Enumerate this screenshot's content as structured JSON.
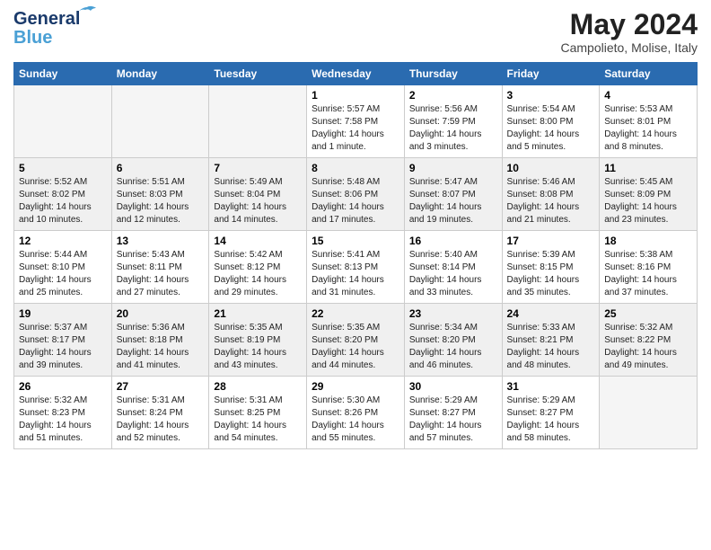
{
  "header": {
    "logo_line1": "General",
    "logo_line2": "Blue",
    "month": "May 2024",
    "location": "Campolieto, Molise, Italy"
  },
  "days_of_week": [
    "Sunday",
    "Monday",
    "Tuesday",
    "Wednesday",
    "Thursday",
    "Friday",
    "Saturday"
  ],
  "weeks": [
    [
      {
        "day": "",
        "info": ""
      },
      {
        "day": "",
        "info": ""
      },
      {
        "day": "",
        "info": ""
      },
      {
        "day": "1",
        "info": "Sunrise: 5:57 AM\nSunset: 7:58 PM\nDaylight: 14 hours\nand 1 minute."
      },
      {
        "day": "2",
        "info": "Sunrise: 5:56 AM\nSunset: 7:59 PM\nDaylight: 14 hours\nand 3 minutes."
      },
      {
        "day": "3",
        "info": "Sunrise: 5:54 AM\nSunset: 8:00 PM\nDaylight: 14 hours\nand 5 minutes."
      },
      {
        "day": "4",
        "info": "Sunrise: 5:53 AM\nSunset: 8:01 PM\nDaylight: 14 hours\nand 8 minutes."
      }
    ],
    [
      {
        "day": "5",
        "info": "Sunrise: 5:52 AM\nSunset: 8:02 PM\nDaylight: 14 hours\nand 10 minutes."
      },
      {
        "day": "6",
        "info": "Sunrise: 5:51 AM\nSunset: 8:03 PM\nDaylight: 14 hours\nand 12 minutes."
      },
      {
        "day": "7",
        "info": "Sunrise: 5:49 AM\nSunset: 8:04 PM\nDaylight: 14 hours\nand 14 minutes."
      },
      {
        "day": "8",
        "info": "Sunrise: 5:48 AM\nSunset: 8:06 PM\nDaylight: 14 hours\nand 17 minutes."
      },
      {
        "day": "9",
        "info": "Sunrise: 5:47 AM\nSunset: 8:07 PM\nDaylight: 14 hours\nand 19 minutes."
      },
      {
        "day": "10",
        "info": "Sunrise: 5:46 AM\nSunset: 8:08 PM\nDaylight: 14 hours\nand 21 minutes."
      },
      {
        "day": "11",
        "info": "Sunrise: 5:45 AM\nSunset: 8:09 PM\nDaylight: 14 hours\nand 23 minutes."
      }
    ],
    [
      {
        "day": "12",
        "info": "Sunrise: 5:44 AM\nSunset: 8:10 PM\nDaylight: 14 hours\nand 25 minutes."
      },
      {
        "day": "13",
        "info": "Sunrise: 5:43 AM\nSunset: 8:11 PM\nDaylight: 14 hours\nand 27 minutes."
      },
      {
        "day": "14",
        "info": "Sunrise: 5:42 AM\nSunset: 8:12 PM\nDaylight: 14 hours\nand 29 minutes."
      },
      {
        "day": "15",
        "info": "Sunrise: 5:41 AM\nSunset: 8:13 PM\nDaylight: 14 hours\nand 31 minutes."
      },
      {
        "day": "16",
        "info": "Sunrise: 5:40 AM\nSunset: 8:14 PM\nDaylight: 14 hours\nand 33 minutes."
      },
      {
        "day": "17",
        "info": "Sunrise: 5:39 AM\nSunset: 8:15 PM\nDaylight: 14 hours\nand 35 minutes."
      },
      {
        "day": "18",
        "info": "Sunrise: 5:38 AM\nSunset: 8:16 PM\nDaylight: 14 hours\nand 37 minutes."
      }
    ],
    [
      {
        "day": "19",
        "info": "Sunrise: 5:37 AM\nSunset: 8:17 PM\nDaylight: 14 hours\nand 39 minutes."
      },
      {
        "day": "20",
        "info": "Sunrise: 5:36 AM\nSunset: 8:18 PM\nDaylight: 14 hours\nand 41 minutes."
      },
      {
        "day": "21",
        "info": "Sunrise: 5:35 AM\nSunset: 8:19 PM\nDaylight: 14 hours\nand 43 minutes."
      },
      {
        "day": "22",
        "info": "Sunrise: 5:35 AM\nSunset: 8:20 PM\nDaylight: 14 hours\nand 44 minutes."
      },
      {
        "day": "23",
        "info": "Sunrise: 5:34 AM\nSunset: 8:20 PM\nDaylight: 14 hours\nand 46 minutes."
      },
      {
        "day": "24",
        "info": "Sunrise: 5:33 AM\nSunset: 8:21 PM\nDaylight: 14 hours\nand 48 minutes."
      },
      {
        "day": "25",
        "info": "Sunrise: 5:32 AM\nSunset: 8:22 PM\nDaylight: 14 hours\nand 49 minutes."
      }
    ],
    [
      {
        "day": "26",
        "info": "Sunrise: 5:32 AM\nSunset: 8:23 PM\nDaylight: 14 hours\nand 51 minutes."
      },
      {
        "day": "27",
        "info": "Sunrise: 5:31 AM\nSunset: 8:24 PM\nDaylight: 14 hours\nand 52 minutes."
      },
      {
        "day": "28",
        "info": "Sunrise: 5:31 AM\nSunset: 8:25 PM\nDaylight: 14 hours\nand 54 minutes."
      },
      {
        "day": "29",
        "info": "Sunrise: 5:30 AM\nSunset: 8:26 PM\nDaylight: 14 hours\nand 55 minutes."
      },
      {
        "day": "30",
        "info": "Sunrise: 5:29 AM\nSunset: 8:27 PM\nDaylight: 14 hours\nand 57 minutes."
      },
      {
        "day": "31",
        "info": "Sunrise: 5:29 AM\nSunset: 8:27 PM\nDaylight: 14 hours\nand 58 minutes."
      },
      {
        "day": "",
        "info": ""
      }
    ]
  ]
}
